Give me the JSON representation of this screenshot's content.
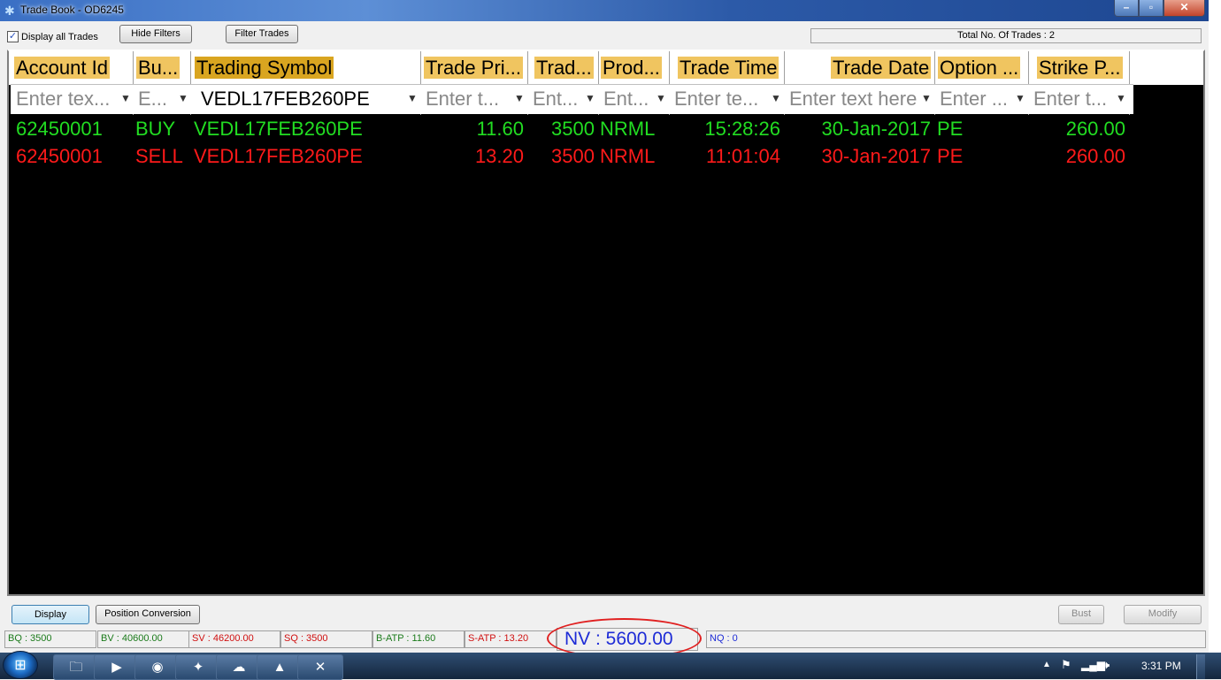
{
  "window": {
    "title": "Trade Book - OD6245"
  },
  "toolbar": {
    "display_all_label": "Display all Trades",
    "display_all_checked": "✓",
    "hide_filters": "Hide Filters",
    "filter_trades": "Filter Trades",
    "total_trades": "Total No. Of Trades : 2"
  },
  "table": {
    "columns": [
      "Account Id",
      "Bu...",
      "Trading Symbol",
      "Trade Pri...",
      "Trad...",
      "Prod...",
      "Trade Time",
      "Trade Date",
      "Option ...",
      "Strike P..."
    ],
    "filters": [
      "Enter tex...",
      "E...",
      "VEDL17FEB260PE",
      "Enter t...",
      "Ent...",
      "Ent...",
      "Enter te...",
      "Enter text here",
      "Enter ...",
      "Enter t..."
    ],
    "rows": [
      {
        "side": "buy",
        "cells": [
          "62450001",
          "BUY",
          "VEDL17FEB260PE",
          "11.60",
          "3500",
          "NRML",
          "15:28:26",
          "30-Jan-2017",
          "PE",
          "260.00"
        ]
      },
      {
        "side": "sell",
        "cells": [
          "62450001",
          "SELL",
          "VEDL17FEB260PE",
          "13.20",
          "3500",
          "NRML",
          "11:01:04",
          "30-Jan-2017",
          "PE",
          "260.00"
        ]
      }
    ]
  },
  "buttons": {
    "display": "Display",
    "position_conversion": "Position Conversion",
    "bust": "Bust",
    "modify": "Modify"
  },
  "status": {
    "bq": "BQ : 3500",
    "bv": "BV : 40600.00",
    "sv": "SV : 46200.00",
    "sq": "SQ : 3500",
    "batp": "B-ATP : 11.60",
    "satp": "S-ATP : 13.20",
    "nv": "NV : 5600.00",
    "nq": "NQ : 0"
  },
  "taskbar": {
    "clock": "3:31 PM"
  },
  "colors": {
    "buy": "#22dd22",
    "sell": "#ff1a1a",
    "header": "#f0c560",
    "header_selected": "#d9a520",
    "nv_text": "#1d2bd6",
    "highlight_ring": "#e02020"
  }
}
